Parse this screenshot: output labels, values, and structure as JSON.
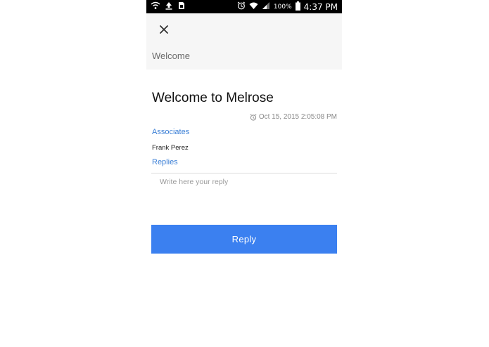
{
  "status_bar": {
    "left_icons": [
      "wifi-call-icon",
      "upload-icon",
      "sim-icon"
    ],
    "right_icons": [
      "alarm-icon",
      "wifi-icon",
      "signal-icon",
      "battery-icon"
    ],
    "battery_percent": "100%",
    "time": "4:37 PM"
  },
  "app_bar": {
    "close_icon": "close-icon",
    "title": "Welcome"
  },
  "message": {
    "title": "Welcome to Melrose",
    "timestamp_icon": "alarm-clock-icon",
    "timestamp": "Oct 15, 2015 2:05:08 PM",
    "associates_label": "Associates",
    "associates": [
      "Frank Perez"
    ],
    "replies_label": "Replies"
  },
  "reply": {
    "placeholder": "Write here your reply",
    "value": "",
    "button_label": "Reply"
  },
  "colors": {
    "accent": "#3b80f0",
    "section_label": "#3b7fd6",
    "appbar_bg": "#f6f6f6",
    "status_bar_bg": "#000000"
  }
}
